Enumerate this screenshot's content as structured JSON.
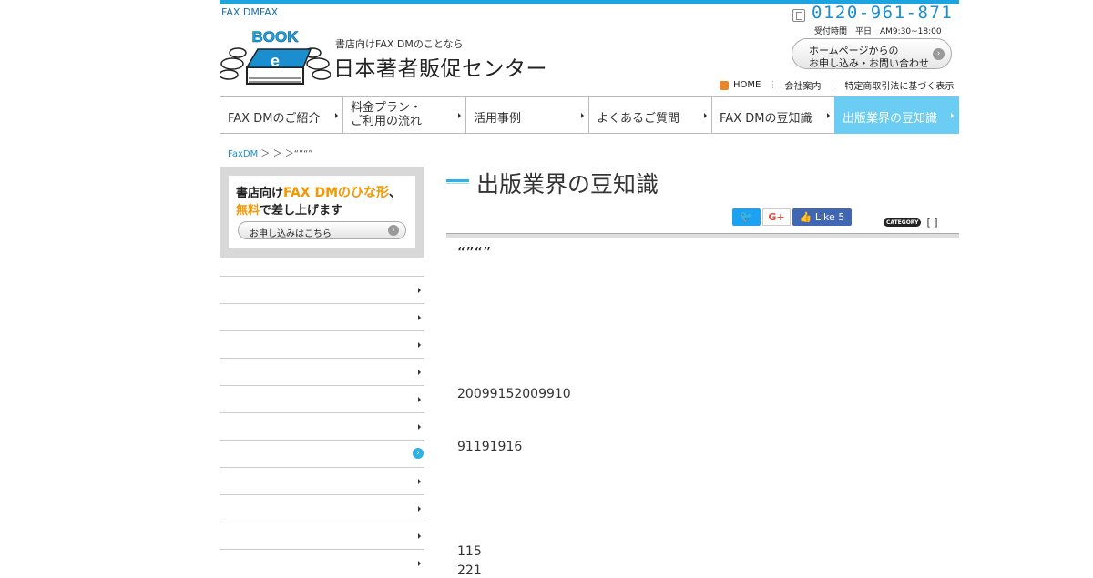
{
  "header": {
    "tagline": "FAX DMFAX",
    "logo": {
      "badge_text": "BOOK",
      "letter": "e"
    },
    "subtitle": "書店向けFAX DMのことなら",
    "site_title": "日本著者販促センター",
    "phone": "0120-961-871",
    "hours": "受付時間　平日　AM9:30~18:00",
    "contact_button": {
      "line1": "ホームページからの",
      "line2": "お申し込み・お問い合わせ",
      "icon": "circle-arrow-right-icon"
    },
    "util_links": [
      "HOME",
      "会社案内",
      "特定商取引法に基づく表示"
    ],
    "colors": {
      "accent": "#1ba4e0",
      "phone": "#1b8ed0",
      "active_nav": "#6ccdf4",
      "highlight": "#f39800"
    }
  },
  "global_nav": {
    "items": [
      {
        "label": "FAX DMのご紹介"
      },
      {
        "label_line1": "料金プラン・",
        "label_line2": "ご利用の流れ"
      },
      {
        "label": "活用事例"
      },
      {
        "label": "よくあるご質問"
      },
      {
        "label": "FAX DMの豆知識"
      },
      {
        "label": "出版業界の豆知識",
        "active": true
      }
    ]
  },
  "breadcrumb": {
    "home": "FaxDM",
    "rest": "＞ ＞ ＞“”“”"
  },
  "side_banner": {
    "l1_pre": "書店向け",
    "l1_hl": "FAX DMのひな形",
    "l1_post": "、",
    "l2_hl": "無料",
    "l2_post": "で差し上げます",
    "button": "お申し込みはこちら"
  },
  "side_menu": {
    "count": 11,
    "active_index": 6
  },
  "main": {
    "heading": "出版業界の豆知識",
    "social": {
      "twitter": "twitter-icon",
      "gplus": "G+",
      "fb_like": "Like",
      "fb_count": "5"
    },
    "category_badge": "CATEGORY",
    "category_value": "[ ]",
    "article_title": "“”“”",
    "paragraphs": [
      "20099152009910",
      "91191916",
      "115",
      "221"
    ]
  }
}
